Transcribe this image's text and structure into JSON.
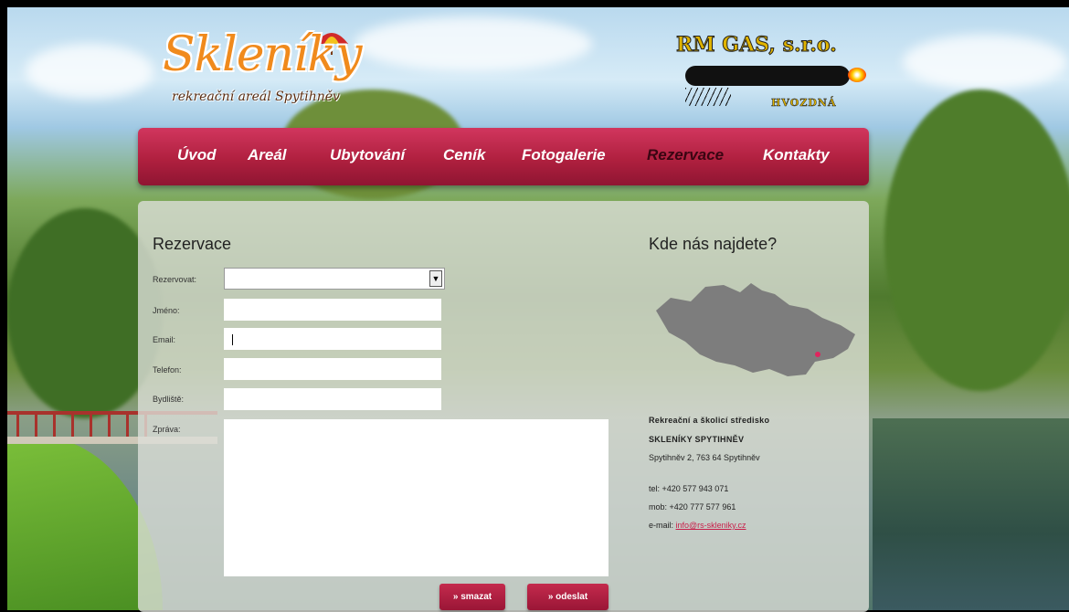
{
  "logos": {
    "left_title": "Skleníky",
    "left_subtitle": "rekreační areál Spytihněv",
    "right_title": "RM GAS, s.r.o.",
    "right_town": "HVOZDNÁ"
  },
  "nav": {
    "items": [
      {
        "label": "Úvod"
      },
      {
        "label": "Areál"
      },
      {
        "label": "Ubytování"
      },
      {
        "label": "Ceník"
      },
      {
        "label": "Fotogalerie"
      },
      {
        "label": "Rezervace",
        "active": true
      },
      {
        "label": "Kontakty"
      }
    ],
    "color_top": "#d1365e",
    "color_bottom": "#8f1532",
    "active_color": "#3a0512"
  },
  "form": {
    "title": "Rezervace",
    "fields": {
      "rezervovat": {
        "label": "Rezervovat:",
        "value": ""
      },
      "jmeno": {
        "label": "Jméno:",
        "value": ""
      },
      "email": {
        "label": "Email:",
        "value": ""
      },
      "telefon": {
        "label": "Telefon:",
        "value": ""
      },
      "bydliste": {
        "label": "Bydliště:",
        "value": ""
      },
      "zprava": {
        "label": "Zpráva:",
        "value": ""
      }
    },
    "buttons": {
      "clear": "» smazat",
      "submit": "» odeslat"
    }
  },
  "contact": {
    "title": "Kde nás najdete?",
    "org_line1": "Rekreační a školicí středisko",
    "org_line2": "SKLENÍKY SPYTIHNĚV",
    "address": "Spytihněv 2, 763 64 Spytihněv",
    "tel": "tel: +420 577 943 071",
    "mob": "mob: +420 777 577 961",
    "email_label": "e-mail:",
    "email": "info@rs-skleniky.cz",
    "map_marker_color": "#e0245e"
  }
}
